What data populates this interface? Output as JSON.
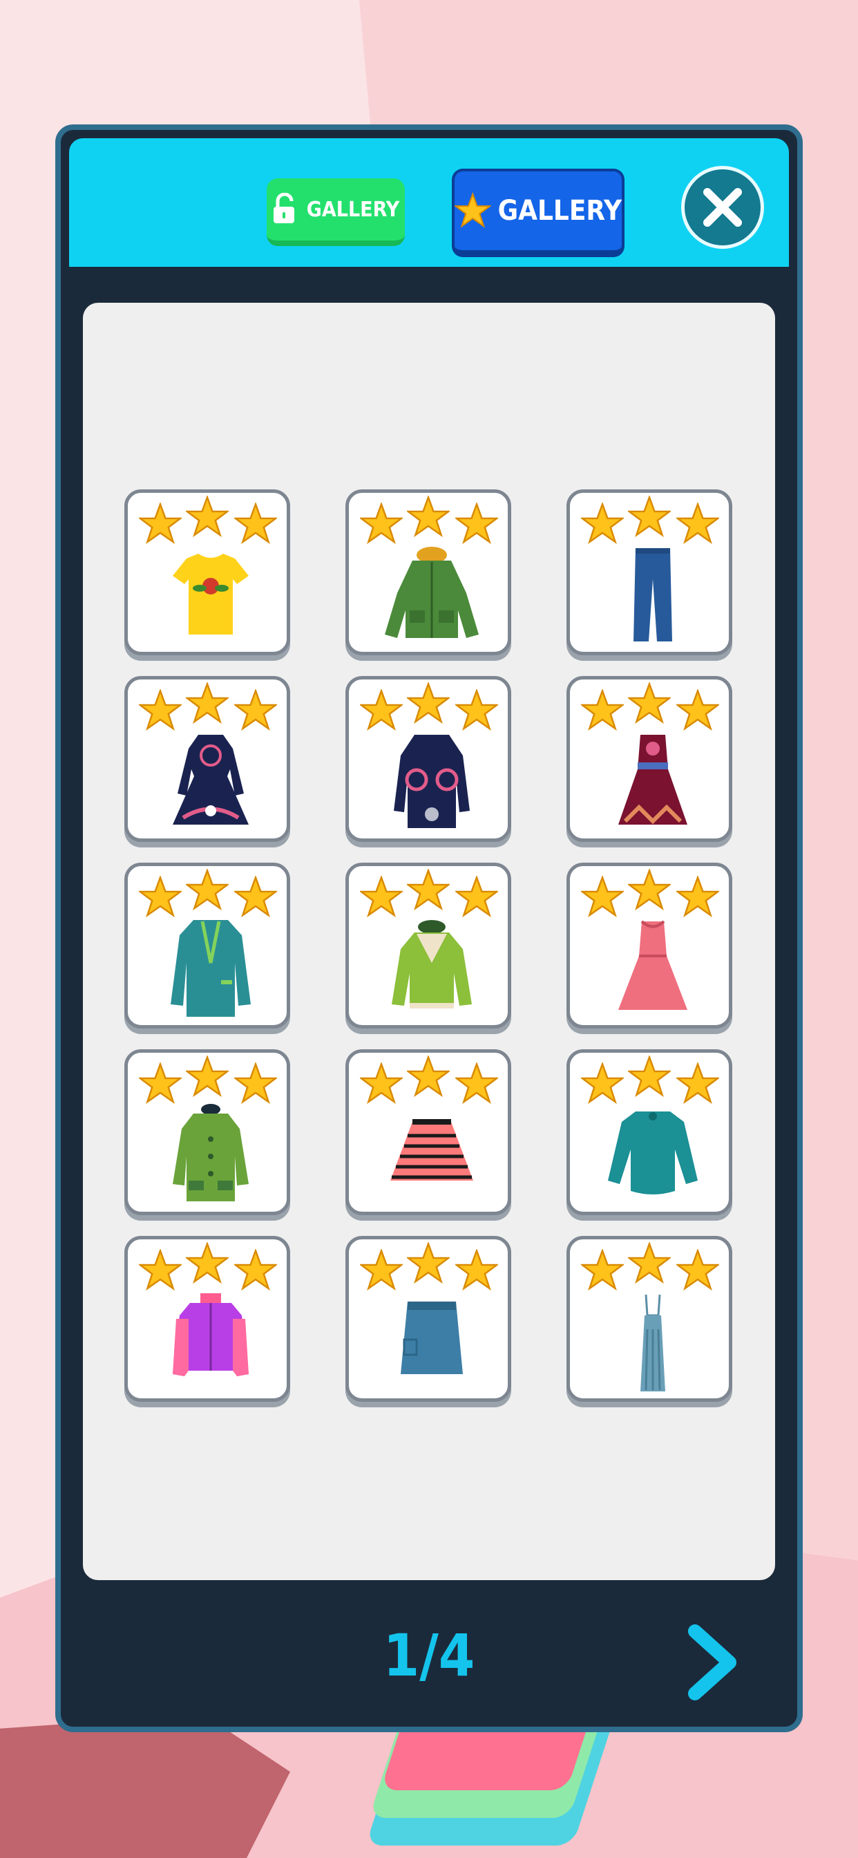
{
  "header": {
    "unlocked_tab_label": "GALLERY",
    "star_tab_label": "GALLERY",
    "close_icon": "close-icon"
  },
  "items": [
    {
      "name": "yellow-tshirt-icon",
      "stars": 3
    },
    {
      "name": "green-parka-icon",
      "stars": 3
    },
    {
      "name": "blue-jeans-icon",
      "stars": 3
    },
    {
      "name": "navy-floral-dress-icon",
      "stars": 3
    },
    {
      "name": "navy-floral-coat-icon",
      "stars": 3
    },
    {
      "name": "burgundy-dress-icon",
      "stars": 3
    },
    {
      "name": "teal-blazer-icon",
      "stars": 3
    },
    {
      "name": "green-shearling-jacket-icon",
      "stars": 3
    },
    {
      "name": "pink-dress-icon",
      "stars": 3
    },
    {
      "name": "green-coat-icon",
      "stars": 3
    },
    {
      "name": "striped-skirt-icon",
      "stars": 3
    },
    {
      "name": "teal-blouse-icon",
      "stars": 3
    },
    {
      "name": "purple-pink-jacket-icon",
      "stars": 3
    },
    {
      "name": "denim-skirt-icon",
      "stars": 3
    },
    {
      "name": "blue-maxi-dress-icon",
      "stars": 3
    }
  ],
  "footer": {
    "page_indicator": "1/4"
  },
  "colors": {
    "header": "#0fd2f3",
    "panel": "#1b2a3b",
    "star": "#ffc21a",
    "accent": "#14c4ec"
  }
}
